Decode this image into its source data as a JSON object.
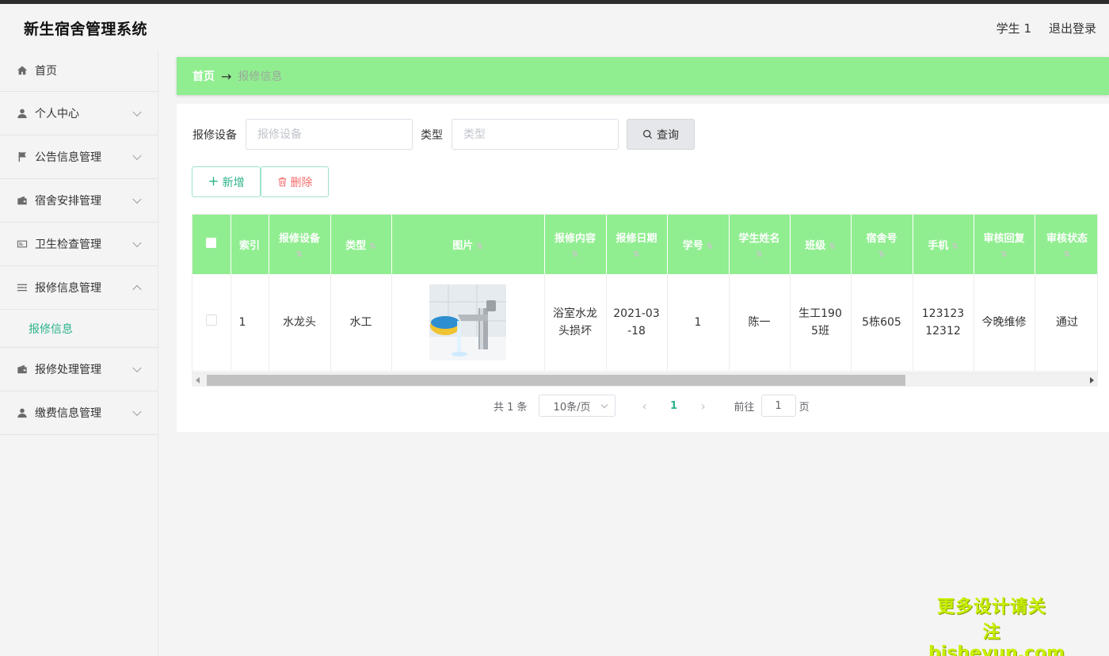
{
  "app": {
    "title": "新生宿舍管理系统"
  },
  "header": {
    "user": "学生 1",
    "logout": "退出登录"
  },
  "sidebar": {
    "items": [
      {
        "label": "首页",
        "icon": "home-icon"
      },
      {
        "label": "个人中心",
        "icon": "user-icon"
      },
      {
        "label": "公告信息管理",
        "icon": "flag-icon"
      },
      {
        "label": "宿舍安排管理",
        "icon": "wallet-icon"
      },
      {
        "label": "卫生检查管理",
        "icon": "id-card-icon"
      },
      {
        "label": "报修信息管理",
        "icon": "list-icon",
        "expanded": true,
        "sub": "报修信息"
      },
      {
        "label": "报修处理管理",
        "icon": "wallet-icon"
      },
      {
        "label": "缴费信息管理",
        "icon": "user-icon"
      }
    ]
  },
  "breadcrumb": {
    "home": "首页",
    "separator": "→",
    "current": "报修信息"
  },
  "search": {
    "field1_label": "报修设备",
    "field1_placeholder": "报修设备",
    "field2_label": "类型",
    "field2_placeholder": "类型",
    "button": "查询"
  },
  "actions": {
    "add": "新增",
    "delete": "删除"
  },
  "table": {
    "headers": [
      "索引",
      "报修设备",
      "类型",
      "图片",
      "报修内容",
      "报修日期",
      "学号",
      "学生姓名",
      "班级",
      "宿舍号",
      "手机",
      "审核回复",
      "审核状态"
    ],
    "rows": [
      {
        "index": "1",
        "device": "水龙头",
        "type": "水工",
        "content": "浴室水龙头损坏",
        "date": "2021-03-18",
        "student_id": "1",
        "name": "陈一",
        "class": "生工1905班",
        "room": "5栋605",
        "phone": "12312312312",
        "reply": "今晚维修",
        "status": "通过"
      }
    ]
  },
  "pagination": {
    "total": "共 1 条",
    "page_size": "10条/页",
    "current": "1",
    "goto_label": "前往",
    "goto_value": "1",
    "page_suffix": "页"
  },
  "watermark": {
    "line1": "更多设计请关注",
    "line2": "bisheyun.com"
  },
  "colors": {
    "accent": "#90ee90",
    "active": "#2bb38a",
    "danger": "#f56c6c"
  }
}
